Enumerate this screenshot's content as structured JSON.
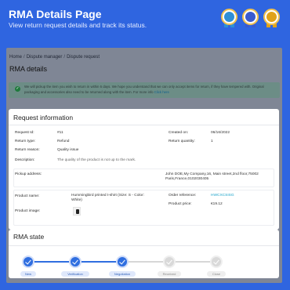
{
  "banner": {
    "title": "RMA Details Page",
    "subtitle": "View return request details and track its status.",
    "badges": [
      {
        "icon": "award-badge-icon",
        "color": "#2f8fd6"
      },
      {
        "icon": "award-badge-icon",
        "color": "#3a5bd0"
      },
      {
        "icon": "award-badge-icon",
        "color": "#e0a21a"
      }
    ]
  },
  "breadcrumb": {
    "home": "Home",
    "parent": "Dispute manager",
    "current": "Dispute request"
  },
  "page_title": "RMA details",
  "alert": {
    "text": "We will pickup the item you wish to return in within 6 days. We hope you understand that we can only accept items for return, if they have tempered with. Original packaging and accessories also need to be returned along with the item. For more info ",
    "link": "Click here",
    "color": "#1f7a3d"
  },
  "request": {
    "heading": "Request information",
    "id_label": "Request Id:",
    "id": "#11",
    "type_label": "Return type:",
    "type": "Refund",
    "reason_label": "Return reason:",
    "reason": "Quality issue",
    "created_label": "Created on:",
    "created": "06/16/2022",
    "qty_label": "Return quantity:",
    "qty": "1",
    "desc_label": "Description:",
    "desc": "The quality of the product is not up to the mark.",
    "pickup_label": "Pickup address:",
    "pickup": "John DOE,My Company,16, Main street,2nd floor,75002 Paris,France,0102030405",
    "product_label": "Product name:",
    "product": "Hummingbird printed t-shirt (Size: S - Color: White)",
    "image_label": "Product image:",
    "order_label": "Order reference:",
    "order": "HWCXCSISG",
    "price_label": "Product price:",
    "price": "€19.12"
  },
  "state": {
    "heading": "RMA state",
    "steps": [
      {
        "label": "New",
        "done": true
      },
      {
        "label": "Verification",
        "done": true
      },
      {
        "label": "Negotiation",
        "done": true
      },
      {
        "label": "Received",
        "done": false
      },
      {
        "label": "Close",
        "done": false
      }
    ],
    "accent": "#2f6ee0"
  }
}
